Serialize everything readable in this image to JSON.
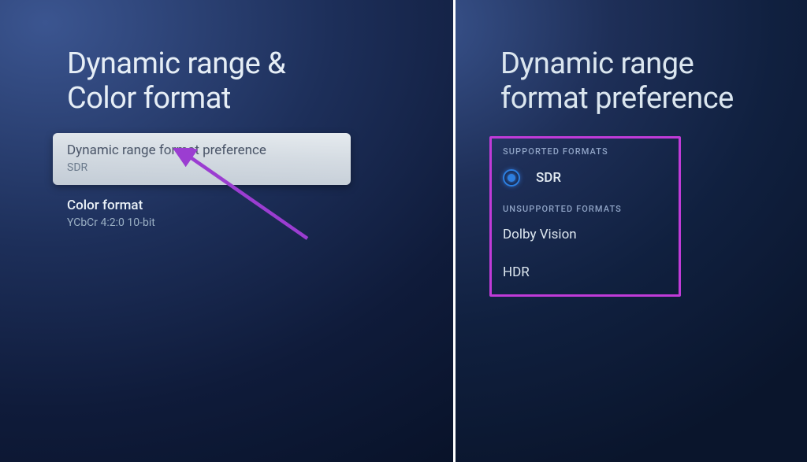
{
  "left": {
    "title_line1": "Dynamic range &",
    "title_line2": "Color format",
    "option_selected": {
      "label": "Dynamic range format preference",
      "value": "SDR"
    },
    "option_plain": {
      "label": "Color format",
      "value": "YCbCr 4:2:0 10-bit"
    }
  },
  "right": {
    "title_line1": "Dynamic range",
    "title_line2": "format preference",
    "supported_header": "SUPPORTED FORMATS",
    "supported_item": "SDR",
    "unsupported_header": "UNSUPPORTED FORMATS",
    "unsupported_items": [
      "Dolby Vision",
      "HDR"
    ]
  },
  "annotation": {
    "highlight_color": "#c03bd8",
    "arrow_color": "#9b3dd1"
  }
}
